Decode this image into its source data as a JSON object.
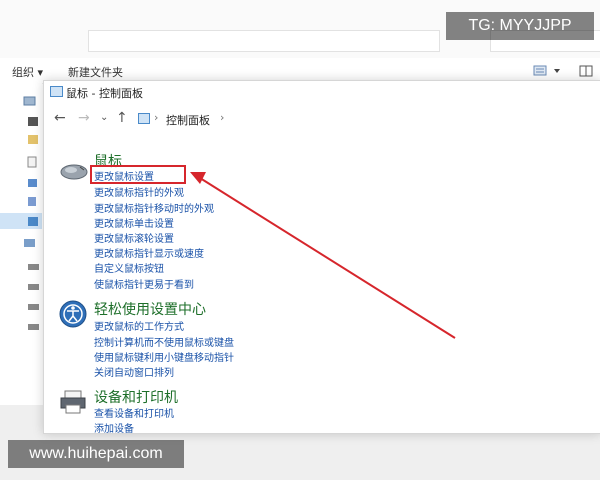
{
  "watermarks": {
    "tg": "TG: MYYJJPP",
    "site": "www.huihepai.com"
  },
  "background_explorer": {
    "toolbar": {
      "organize": "组织 ▾",
      "new_folder": "新建文件夹"
    }
  },
  "window": {
    "title": "鼠标 - 控制面板",
    "breadcrumb": {
      "item": "控制面板",
      "separator": "›"
    },
    "nav": {
      "back": "←",
      "forward": "→",
      "recent": "⌄",
      "up": "↑"
    }
  },
  "groups": [
    {
      "title": "鼠标",
      "icon": "mouse-icon",
      "links": [
        "更改鼠标设置",
        "更改鼠标指针的外观",
        "更改鼠标指针移动时的外观",
        "更改鼠标单击设置",
        "更改鼠标滚轮设置",
        "更改鼠标指针显示或速度",
        "自定义鼠标按钮",
        "使鼠标指针更易于看到"
      ]
    },
    {
      "title": "轻松使用设置中心",
      "icon": "ease-of-access-icon",
      "links": [
        "更改鼠标的工作方式",
        "控制计算机而不使用鼠标或键盘",
        "使用鼠标键利用小键盘移动指针",
        "关闭自动窗口排列"
      ]
    },
    {
      "title": "设备和打印机",
      "icon": "printer-icon",
      "links": [
        "查看设备和打印机",
        "添加设备"
      ]
    }
  ],
  "annotation": {
    "highlight_color": "#d6262c"
  }
}
